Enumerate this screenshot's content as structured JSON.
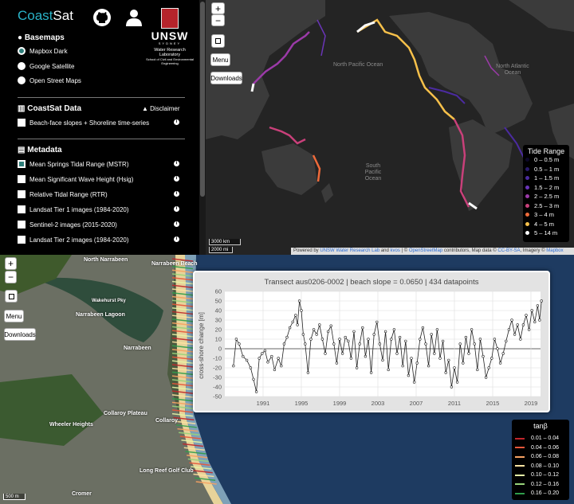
{
  "app": {
    "logo_part1": "Coast",
    "logo_part2": "Sat"
  },
  "unsw": {
    "name": "UNSW",
    "city": "SYDNEY",
    "lab": "Water Research Laboratory",
    "school": "School of Civil and Environmental Engineering"
  },
  "sidebar": {
    "basemaps_title": "Basemaps",
    "basemaps": [
      "Mapbox Dark",
      "Google Satellite",
      "Open Street Maps"
    ],
    "coastsat_title": "CoastSat Data",
    "disclaimer": "Disclaimer",
    "coastsat_items": [
      "Beach-face slopes + Shoreline time-series"
    ],
    "metadata_title": "Metadata",
    "metadata_items": [
      "Mean Springs Tidal Range (MSTR)",
      "Mean Significant Wave Height (Hsig)",
      "Relative Tidal Range (RTR)",
      "Landsat Tier 1 images (1984-2020)",
      "Sentinel-2 images (2015-2020)",
      "Landsat Tier 2 images (1984-2020)"
    ]
  },
  "map_controls": {
    "zoom_in": "+",
    "zoom_out": "−",
    "menu": "Menu",
    "downloads": "Downloads"
  },
  "oceans": {
    "npacific": "North Pacific Ocean",
    "natlantic": "North Atlantic Ocean",
    "spacific": "South Pacific Ocean"
  },
  "scale_top": {
    "km": "3000 km",
    "mi": "2000 mi"
  },
  "scale_bottom": {
    "m": "500 m"
  },
  "attribution": {
    "pre": "Powered by",
    "l1": "UNSW Water Research Lab",
    "and": "and",
    "l2": "kvos",
    "mid": "| ©",
    "l3": "OpenStreetMap",
    "mid2": "contributors, Map data ©",
    "l4": "CC-BY-SA",
    "mid3": ", Imagery ©",
    "l5": "Mapbox"
  },
  "tide_legend": {
    "title": "Tide Range",
    "items": [
      {
        "label": "0 – 0.5 m",
        "color": "#0d0829"
      },
      {
        "label": "0.5 – 1 m",
        "color": "#2a1b6b"
      },
      {
        "label": "1 – 1.5 m",
        "color": "#4b2ba0"
      },
      {
        "label": "1.5 – 2 m",
        "color": "#6a35b8"
      },
      {
        "label": "2 – 2.5 m",
        "color": "#9b3aa8"
      },
      {
        "label": "2.5 – 3 m",
        "color": "#c9407a"
      },
      {
        "label": "3 – 4 m",
        "color": "#ee6a3a"
      },
      {
        "label": "4 – 5 m",
        "color": "#f6c04a"
      },
      {
        "label": "5 – 14 m",
        "color": "#fafafa"
      }
    ]
  },
  "places": [
    "North Narrabeen",
    "Narrabeen Beach",
    "Narrabeen Lagoon",
    "Wakehurst Pky",
    "Narrabeen",
    "Collaroy Plateau",
    "Wheeler Heights",
    "Long Reef Golf Club",
    "Cromer",
    "Collaroy"
  ],
  "tan_legend": {
    "title": "tanβ",
    "items": [
      {
        "label": "0.01 – 0.04",
        "color": "#c0262b"
      },
      {
        "label": "0.04 – 0.06",
        "color": "#e8563a"
      },
      {
        "label": "0.06 – 0.08",
        "color": "#f8a262"
      },
      {
        "label": "0.08 – 0.10",
        "color": "#fde3a1"
      },
      {
        "label": "0.10 – 0.12",
        "color": "#e5f5a6"
      },
      {
        "label": "0.12 – 0.16",
        "color": "#98d47a"
      },
      {
        "label": "0.16 – 0.20",
        "color": "#2f9e4b"
      }
    ]
  },
  "chart_data": {
    "type": "line",
    "title": "Transect aus0206-0002   |   beach slope = 0.0650   |   434 datapoints",
    "ylabel": "cross-shore change [m]",
    "xlabel": "",
    "ylim": [
      -50,
      60
    ],
    "xlim": [
      1987,
      2020
    ],
    "xticks": [
      1991,
      1995,
      1999,
      2003,
      2007,
      2011,
      2015,
      2019
    ],
    "yticks": [
      -50,
      -40,
      -30,
      -20,
      -10,
      0,
      10,
      20,
      30,
      40,
      50,
      60
    ],
    "grid": true,
    "series": [
      {
        "values": [
          [
            1987.9,
            -18
          ],
          [
            1988.2,
            10
          ],
          [
            1988.5,
            5
          ],
          [
            1988.9,
            -8
          ],
          [
            1989.3,
            -12
          ],
          [
            1989.7,
            -20
          ],
          [
            1990.0,
            -32
          ],
          [
            1990.3,
            -45
          ],
          [
            1990.6,
            -10
          ],
          [
            1990.9,
            -5
          ],
          [
            1991.2,
            -2
          ],
          [
            1991.5,
            -14
          ],
          [
            1991.9,
            -8
          ],
          [
            1992.2,
            -22
          ],
          [
            1992.6,
            -10
          ],
          [
            1992.9,
            -18
          ],
          [
            1993.2,
            5
          ],
          [
            1993.5,
            12
          ],
          [
            1993.8,
            22
          ],
          [
            1994.1,
            28
          ],
          [
            1994.4,
            35
          ],
          [
            1994.6,
            25
          ],
          [
            1994.8,
            50
          ],
          [
            1995.0,
            40
          ],
          [
            1995.2,
            15
          ],
          [
            1995.4,
            5
          ],
          [
            1995.7,
            -25
          ],
          [
            1996.0,
            10
          ],
          [
            1996.3,
            20
          ],
          [
            1996.6,
            15
          ],
          [
            1996.9,
            25
          ],
          [
            1997.2,
            10
          ],
          [
            1997.5,
            -5
          ],
          [
            1997.8,
            18
          ],
          [
            1998.1,
            24
          ],
          [
            1998.4,
            5
          ],
          [
            1998.7,
            -15
          ],
          [
            1999.0,
            10
          ],
          [
            1999.3,
            -5
          ],
          [
            1999.6,
            12
          ],
          [
            1999.9,
            8
          ],
          [
            2000.2,
            -10
          ],
          [
            2000.5,
            18
          ],
          [
            2000.8,
            -20
          ],
          [
            2001.1,
            5
          ],
          [
            2001.4,
            22
          ],
          [
            2001.7,
            -8
          ],
          [
            2002.0,
            10
          ],
          [
            2002.3,
            -25
          ],
          [
            2002.6,
            15
          ],
          [
            2002.9,
            28
          ],
          [
            2003.2,
            5
          ],
          [
            2003.5,
            -12
          ],
          [
            2003.8,
            18
          ],
          [
            2004.1,
            -22
          ],
          [
            2004.4,
            10
          ],
          [
            2004.7,
            20
          ],
          [
            2005.0,
            -5
          ],
          [
            2005.3,
            12
          ],
          [
            2005.6,
            -18
          ],
          [
            2005.9,
            8
          ],
          [
            2006.2,
            -28
          ],
          [
            2006.5,
            -10
          ],
          [
            2006.8,
            -35
          ],
          [
            2007.1,
            -15
          ],
          [
            2007.4,
            10
          ],
          [
            2007.7,
            22
          ],
          [
            2008.0,
            5
          ],
          [
            2008.3,
            -18
          ],
          [
            2008.6,
            15
          ],
          [
            2008.9,
            -5
          ],
          [
            2009.2,
            20
          ],
          [
            2009.5,
            -10
          ],
          [
            2009.8,
            8
          ],
          [
            2010.1,
            -25
          ],
          [
            2010.4,
            -12
          ],
          [
            2010.7,
            -40
          ],
          [
            2011.0,
            -20
          ],
          [
            2011.3,
            -35
          ],
          [
            2011.6,
            5
          ],
          [
            2011.9,
            -15
          ],
          [
            2012.2,
            12
          ],
          [
            2012.5,
            -5
          ],
          [
            2012.8,
            20
          ],
          [
            2013.1,
            5
          ],
          [
            2013.4,
            -22
          ],
          [
            2013.7,
            10
          ],
          [
            2014.0,
            -8
          ],
          [
            2014.3,
            -30
          ],
          [
            2014.6,
            -20
          ],
          [
            2014.9,
            -10
          ],
          [
            2015.2,
            10
          ],
          [
            2015.5,
            0
          ],
          [
            2015.8,
            -15
          ],
          [
            2016.1,
            -5
          ],
          [
            2016.4,
            8
          ],
          [
            2016.7,
            20
          ],
          [
            2017.0,
            30
          ],
          [
            2017.3,
            15
          ],
          [
            2017.6,
            25
          ],
          [
            2017.9,
            10
          ],
          [
            2018.2,
            25
          ],
          [
            2018.5,
            35
          ],
          [
            2018.8,
            20
          ],
          [
            2019.1,
            40
          ],
          [
            2019.4,
            28
          ],
          [
            2019.7,
            45
          ],
          [
            2019.9,
            30
          ],
          [
            2020.1,
            50
          ]
        ]
      }
    ]
  }
}
